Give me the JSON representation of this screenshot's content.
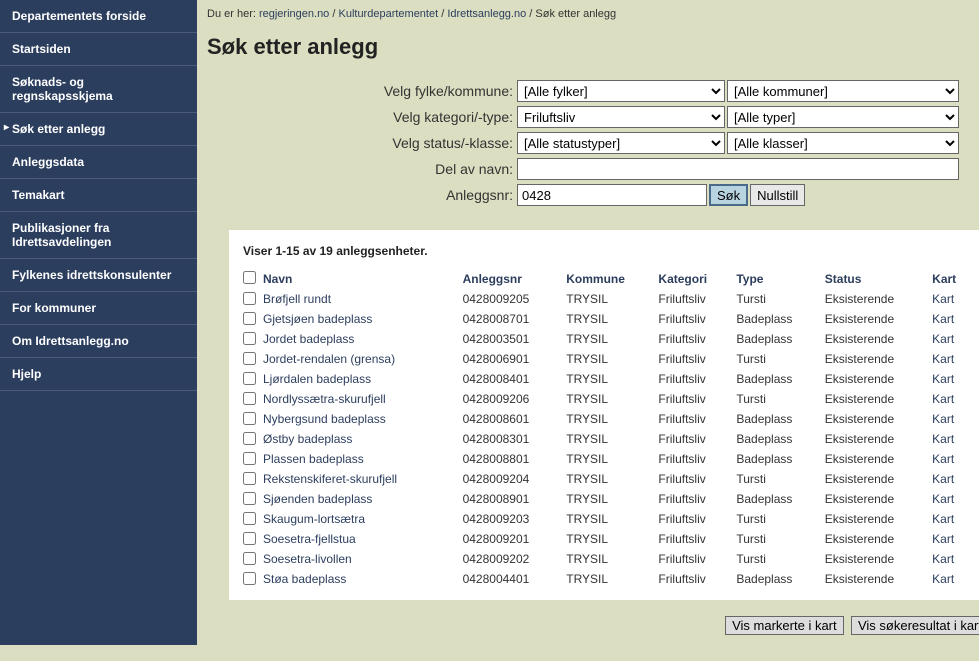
{
  "breadcrumb": {
    "prefix": "Du er her: ",
    "items": [
      "regjeringen.no",
      "Kulturdepartementet",
      "Idrettsanlegg.no",
      "Søk etter anlegg"
    ]
  },
  "title": "Søk etter anlegg",
  "sidebar": {
    "items": [
      "Departementets forside",
      "Startsiden",
      "Søknads- og regnskapsskjema",
      "Søk etter anlegg",
      "Anleggsdata",
      "Temakart",
      "Publikasjoner fra Idrettsavdelingen",
      "Fylkenes idrettskonsulenter",
      "For kommuner",
      "Om Idrettsanlegg.no",
      "Hjelp"
    ],
    "activeIndex": 3
  },
  "form": {
    "labels": {
      "fylke": "Velg fylke/kommune:",
      "kategori": "Velg kategori/-type:",
      "status": "Velg status/-klasse:",
      "navn": "Del av navn:",
      "anleggsnr": "Anleggsnr:"
    },
    "values": {
      "fylke": "[Alle fylker]",
      "kommune": "[Alle kommuner]",
      "kategori": "Friluftsliv",
      "type": "[Alle typer]",
      "status": "[Alle statustyper]",
      "klasse": "[Alle klasser]",
      "navn": "",
      "anleggsnr": "0428"
    },
    "buttons": {
      "search": "Søk",
      "reset": "Nullstill"
    }
  },
  "results": {
    "countText": "Viser 1-15 av 19 anleggsenheter.",
    "headers": {
      "navn": "Navn",
      "anleggsnr": "Anleggsnr",
      "kommune": "Kommune",
      "kategori": "Kategori",
      "type": "Type",
      "status": "Status",
      "kart": "Kart"
    },
    "kartLabel": "Kart",
    "rows": [
      {
        "navn": "Brøfjell rundt",
        "anleggsnr": "0428009205",
        "kommune": "TRYSIL",
        "kategori": "Friluftsliv",
        "type": "Tursti",
        "status": "Eksisterende"
      },
      {
        "navn": "Gjetsjøen badeplass",
        "anleggsnr": "0428008701",
        "kommune": "TRYSIL",
        "kategori": "Friluftsliv",
        "type": "Badeplass",
        "status": "Eksisterende"
      },
      {
        "navn": "Jordet badeplass",
        "anleggsnr": "0428003501",
        "kommune": "TRYSIL",
        "kategori": "Friluftsliv",
        "type": "Badeplass",
        "status": "Eksisterende"
      },
      {
        "navn": "Jordet-rendalen (grensa)",
        "anleggsnr": "0428006901",
        "kommune": "TRYSIL",
        "kategori": "Friluftsliv",
        "type": "Tursti",
        "status": "Eksisterende"
      },
      {
        "navn": "Ljørdalen badeplass",
        "anleggsnr": "0428008401",
        "kommune": "TRYSIL",
        "kategori": "Friluftsliv",
        "type": "Badeplass",
        "status": "Eksisterende"
      },
      {
        "navn": "Nordlyssætra-skurufjell",
        "anleggsnr": "0428009206",
        "kommune": "TRYSIL",
        "kategori": "Friluftsliv",
        "type": "Tursti",
        "status": "Eksisterende"
      },
      {
        "navn": "Nybergsund badeplass",
        "anleggsnr": "0428008601",
        "kommune": "TRYSIL",
        "kategori": "Friluftsliv",
        "type": "Badeplass",
        "status": "Eksisterende"
      },
      {
        "navn": "Østby badeplass",
        "anleggsnr": "0428008301",
        "kommune": "TRYSIL",
        "kategori": "Friluftsliv",
        "type": "Badeplass",
        "status": "Eksisterende"
      },
      {
        "navn": "Plassen badeplass",
        "anleggsnr": "0428008801",
        "kommune": "TRYSIL",
        "kategori": "Friluftsliv",
        "type": "Badeplass",
        "status": "Eksisterende"
      },
      {
        "navn": "Rekstenskiferet-skurufjell",
        "anleggsnr": "0428009204",
        "kommune": "TRYSIL",
        "kategori": "Friluftsliv",
        "type": "Tursti",
        "status": "Eksisterende"
      },
      {
        "navn": "Sjøenden badeplass",
        "anleggsnr": "0428008901",
        "kommune": "TRYSIL",
        "kategori": "Friluftsliv",
        "type": "Badeplass",
        "status": "Eksisterende"
      },
      {
        "navn": "Skaugum-lortsætra",
        "anleggsnr": "0428009203",
        "kommune": "TRYSIL",
        "kategori": "Friluftsliv",
        "type": "Tursti",
        "status": "Eksisterende"
      },
      {
        "navn": "Soesetra-fjellstua",
        "anleggsnr": "0428009201",
        "kommune": "TRYSIL",
        "kategori": "Friluftsliv",
        "type": "Tursti",
        "status": "Eksisterende"
      },
      {
        "navn": "Soesetra-livollen",
        "anleggsnr": "0428009202",
        "kommune": "TRYSIL",
        "kategori": "Friluftsliv",
        "type": "Tursti",
        "status": "Eksisterende"
      },
      {
        "navn": "Støa badeplass",
        "anleggsnr": "0428004401",
        "kommune": "TRYSIL",
        "kategori": "Friluftsliv",
        "type": "Badeplass",
        "status": "Eksisterende"
      }
    ]
  },
  "bottomButtons": {
    "marked": "Vis markerte i kart",
    "all": "Vis søkeresultat i kart"
  }
}
